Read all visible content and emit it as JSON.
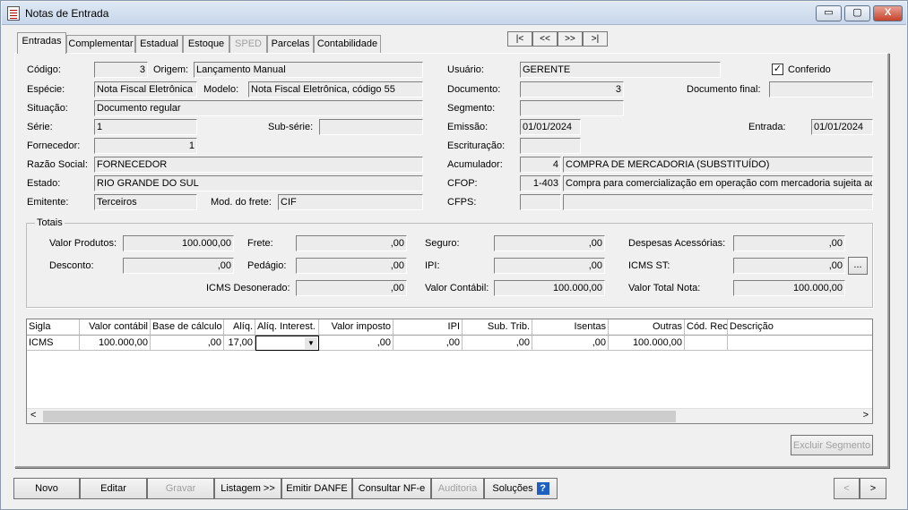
{
  "window": {
    "title": "Notas de Entrada",
    "min_glyph": "▭",
    "max_glyph": "▢",
    "close_glyph": "X"
  },
  "tabs": [
    {
      "label": "Entradas"
    },
    {
      "label": "Complementar"
    },
    {
      "label": "Estadual"
    },
    {
      "label": "Estoque"
    },
    {
      "label": "SPED"
    },
    {
      "label": "Parcelas"
    },
    {
      "label": "Contabilidade"
    }
  ],
  "nav": {
    "first": "|<",
    "prev": "<<",
    "next": ">>",
    "last": ">|"
  },
  "left": {
    "codigo_label": "Código:",
    "codigo": "3",
    "origem_label": "Origem:",
    "origem": "Lançamento Manual",
    "especie_label": "Espécie:",
    "especie": "Nota Fiscal Eletrônica",
    "modelo_label": "Modelo:",
    "modelo": "Nota Fiscal Eletrônica, código 55",
    "situacao_label": "Situação:",
    "situacao": "Documento regular",
    "serie_label": "Série:",
    "serie": "1",
    "subserie_label": "Sub-série:",
    "subserie": "",
    "fornecedor_label": "Fornecedor:",
    "fornecedor": "1",
    "razao_label": "Razão Social:",
    "razao": "FORNECEDOR",
    "estado_label": "Estado:",
    "estado": "RIO GRANDE DO SUL",
    "emitente_label": "Emitente:",
    "emitente": "Terceiros",
    "frete_label": "Mod. do frete:",
    "frete": "CIF"
  },
  "right": {
    "usuario_label": "Usuário:",
    "usuario": "GERENTE",
    "conferido_label": "Conferido",
    "conferido_mark": "✓",
    "documento_label": "Documento:",
    "documento": "3",
    "docfinal_label": "Documento final:",
    "docfinal": "",
    "segmento_label": "Segmento:",
    "segmento": "",
    "emissao_label": "Emissão:",
    "emissao": "01/01/2024",
    "entrada_label": "Entrada:",
    "entrada": "01/01/2024",
    "escrituracao_label": "Escrituração:",
    "escrituracao": "",
    "acumulador_label": "Acumulador:",
    "acumulador_code": "4",
    "acumulador": "COMPRA DE MERCADORIA (SUBSTITUÍDO)",
    "cfop_label": "CFOP:",
    "cfop_code": "1-403",
    "cfop": "Compra para comercialização em operação com mercadoria sujeita ao re",
    "cfps_label": "CFPS:",
    "cfps_code": "",
    "cfps": ""
  },
  "totais": {
    "title": "Totais",
    "valor_produtos_label": "Valor Produtos:",
    "valor_produtos": "100.000,00",
    "desconto_label": "Desconto:",
    "desconto": ",00",
    "frete_label": "Frete:",
    "frete": ",00",
    "pedagio_label": "Pedágio:",
    "pedagio": ",00",
    "icms_desonerado_label": "ICMS Desonerado:",
    "icms_desonerado": ",00",
    "seguro_label": "Seguro:",
    "seguro": ",00",
    "ipi_label": "IPI:",
    "ipi": ",00",
    "valor_contabil_label": "Valor Contábil:",
    "valor_contabil": "100.000,00",
    "despesas_label": "Despesas Acessórias:",
    "despesas": ",00",
    "icms_st_label": "ICMS ST:",
    "icms_st": ",00",
    "icms_st_btn": "...",
    "valor_total_label": "Valor Total Nota:",
    "valor_total": "100.000,00"
  },
  "grid": {
    "headers": [
      "Sigla",
      "Valor contábil",
      "Base de cálculo",
      "Alíq.",
      "Alíq. Interest.",
      "Valor imposto",
      "IPI",
      "Sub. Trib.",
      "Isentas",
      "Outras",
      "Cód. Rec.",
      "Descrição"
    ],
    "row": [
      "ICMS",
      "100.000,00",
      ",00",
      "17,00",
      "",
      ",00",
      ",00",
      ",00",
      ",00",
      "100.000,00",
      "",
      ""
    ],
    "dropdown_glyph": "▼",
    "scroll_left": "<",
    "scroll_right": ">"
  },
  "excluir_segmento": "Excluir Segmento",
  "buttons": {
    "novo": "Novo",
    "editar": "Editar",
    "gravar": "Gravar",
    "listagem": "Listagem >>",
    "emitir": "Emitir DANFE",
    "consultar": "Consultar NF-e",
    "auditoria": "Auditoria",
    "solucoes": "Soluções",
    "help": "?",
    "prev": "<",
    "next": ">"
  }
}
